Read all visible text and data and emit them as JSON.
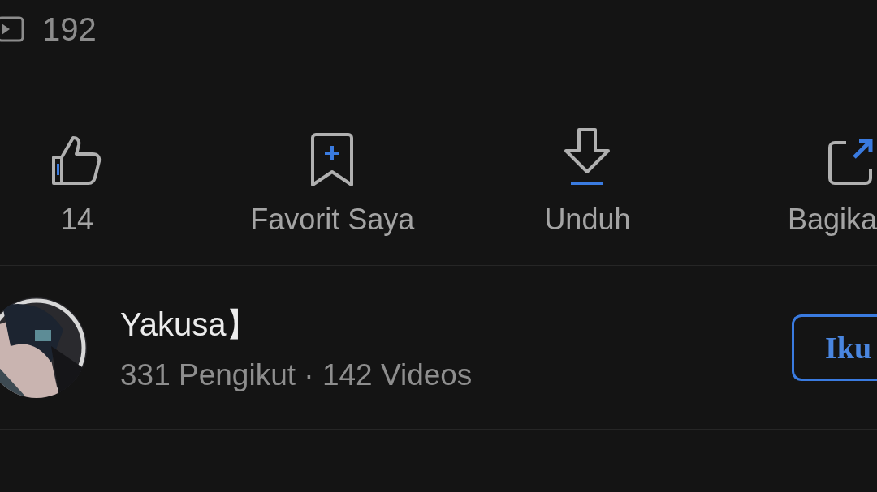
{
  "stats": {
    "views": "192"
  },
  "actions": [
    {
      "kind": "like",
      "label": "14"
    },
    {
      "kind": "favorite",
      "label": "Favorit Saya"
    },
    {
      "kind": "download",
      "label": "Unduh"
    },
    {
      "kind": "share",
      "label": "Bagika"
    }
  ],
  "channel": {
    "name": "Yakusa】",
    "meta": "331 Pengikut · 142 Videos",
    "follow_button": "Iku"
  }
}
